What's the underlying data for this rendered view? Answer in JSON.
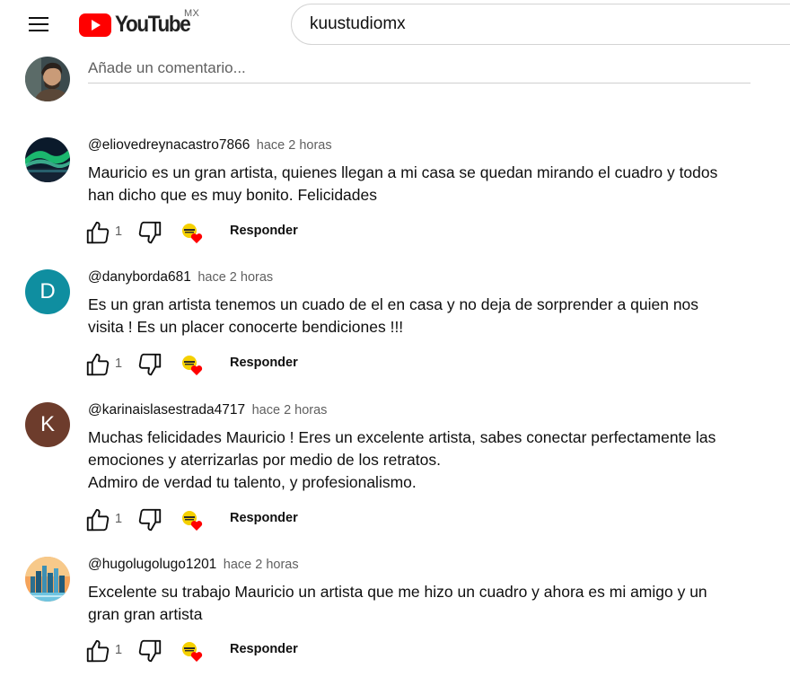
{
  "header": {
    "logo_text": "YouTube",
    "region": "MX",
    "search_value": "kuustudiomx"
  },
  "add_comment": {
    "placeholder": "Añade un comentario..."
  },
  "reply_label": "Responder",
  "comments": [
    {
      "author": "@eliovedreynacastro7866",
      "time": "hace 2 horas",
      "text": "Mauricio es un gran artista, quienes llegan a mi casa se quedan mirando el cuadro y todos han dicho que es muy bonito. Felicidades",
      "likes": "1"
    },
    {
      "author": "@danyborda681",
      "time": "hace 2 horas",
      "text": "Es un gran artista tenemos un cuado de el en casa y no deja de sorprender a quien nos visita ! Es un placer conocerte bendiciones !!!",
      "likes": "1",
      "avatar_letter": "D",
      "avatar_color": "#0f8ea0"
    },
    {
      "author": "@karinaislasestrada4717",
      "time": "hace 2 horas",
      "text": "Muchas felicidades Mauricio ! Eres un excelente artista, sabes conectar perfectamente las emociones y aterrizarlas por medio de los retratos.\nAdmiro de verdad tu talento, y profesionalismo.",
      "likes": "1",
      "avatar_letter": "K",
      "avatar_color": "#6d3c2c"
    },
    {
      "author": "@hugolugolugo1201",
      "time": "hace 2 horas",
      "text": "Excelente su trabajo Mauricio un artista que me hizo un cuadro y ahora es mi amigo y un gran gran artista",
      "likes": "1"
    }
  ],
  "colors": {
    "logo_red": "#ff0000",
    "heart_red": "#ff0000",
    "badge_yellow": "#f5d000"
  }
}
